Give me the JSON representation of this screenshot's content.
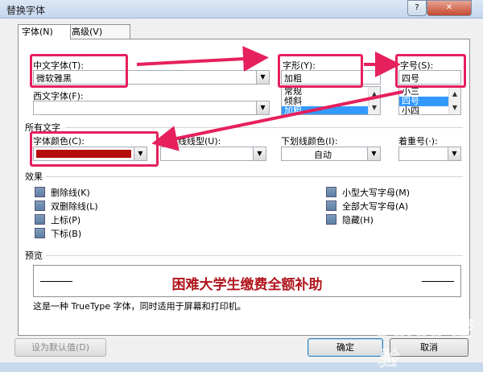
{
  "window": {
    "title": "替换字体",
    "help_icon": "?",
    "close_icon": "✕"
  },
  "tabs": [
    {
      "label": "字体(N)"
    },
    {
      "label": "高级(V)"
    }
  ],
  "font": {
    "chinese_label": "中文字体(T):",
    "chinese_value": "微软雅黑",
    "western_label": "西文字体(F):",
    "western_value": "",
    "style_label": "字形(Y):",
    "style_value": "加粗",
    "style_options": [
      "常规",
      "倾斜",
      "加粗"
    ],
    "size_label": "字号(S):",
    "size_value": "四号",
    "size_options": [
      "小三",
      "四号",
      "小四"
    ]
  },
  "all_text": {
    "section_label": "所有文字",
    "color_label": "字体颜色(C):",
    "color_value": "#b50d0d",
    "underline_label": "下划线线型(U):",
    "underline_value": "",
    "underline_color_label": "下划线颜色(I):",
    "underline_color_value": "自动",
    "emphasis_label": "着重号(·):",
    "emphasis_value": ""
  },
  "effects": {
    "section_label": "效果",
    "left": [
      "删除线(K)",
      "双删除线(L)",
      "上标(P)",
      "下标(B)"
    ],
    "right": [
      "小型大写字母(M)",
      "全部大写字母(A)",
      "隐藏(H)"
    ]
  },
  "preview": {
    "section_label": "预览",
    "sample": "困难大学生缴费全额补助",
    "note": "这是一种 TrueType 字体，同时适用于屏幕和打印机。"
  },
  "buttons": {
    "default_label": "设为默认值(D)",
    "ok_label": "确定",
    "cancel_label": "取消"
  },
  "watermark": "Baidu 经验"
}
